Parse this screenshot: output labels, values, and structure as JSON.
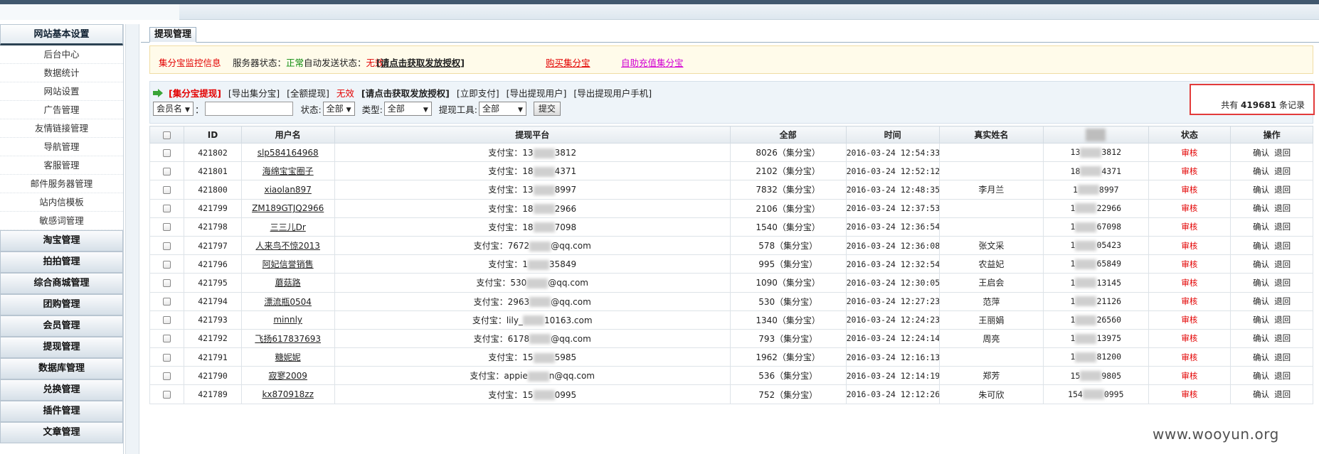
{
  "sidebar": {
    "title": "网站基本设置",
    "items": [
      "后台中心",
      "数据统计",
      "网站设置",
      "广告管理",
      "友情链接管理",
      "导航管理",
      "客服管理",
      "邮件服务器管理",
      "站内信模板",
      "敏感词管理"
    ],
    "groups": [
      "淘宝管理",
      "拍拍管理",
      "综合商城管理",
      "团购管理",
      "会员管理",
      "提现管理",
      "数据库管理",
      "兑换管理",
      "插件管理",
      "文章管理"
    ]
  },
  "tab": {
    "label": "提现管理"
  },
  "monitor": {
    "title": "集分宝监控信息",
    "server_label": "服务器状态：",
    "server_value": "正常",
    "auto_label": "自动发送状态：",
    "auto_value": "无效",
    "auth_link": "[请点击获取发放授权]",
    "buy_link": "购买集分宝",
    "recharge_link": "自助充值集分宝"
  },
  "links": {
    "jfb_withdraw": "[集分宝提现]",
    "export_jfb": "[导出集分宝]",
    "full_withdraw": "[全额提现]",
    "invalid": "无效",
    "auth": "[请点击获取发放授权]",
    "pay_now": "[立即支付]",
    "export_users": "[导出提现用户]",
    "export_phones": "[导出提现用户手机]"
  },
  "filters": {
    "member_select": "会员名",
    "colon": "：",
    "status_label": "状态:",
    "status_value": "全部",
    "type_label": "类型:",
    "type_value": "全部",
    "tool_label": "提现工具:",
    "tool_value": "全部",
    "submit": "提交"
  },
  "total": {
    "prefix": "共有",
    "count": "419681",
    "suffix": "条记录"
  },
  "table": {
    "headers": [
      "ID",
      "用户名",
      "提现平台",
      "全部",
      "时间",
      "真实姓名",
      "状态",
      "操作"
    ],
    "status_text": "审核",
    "op_confirm": "确认",
    "op_back": "退回",
    "rows": [
      {
        "id": "421802",
        "user": "slp584164968",
        "platform_a": "支付宝：13",
        "platform_b": "3812",
        "amount": "8026（集分宝）",
        "time": "2016-03-24 12:54:33",
        "name": "",
        "phone_a": "13",
        "phone_b": "3812"
      },
      {
        "id": "421801",
        "user": "海绵宝宝圈子",
        "platform_a": "支付宝：18",
        "platform_b": "4371",
        "amount": "2102（集分宝）",
        "time": "2016-03-24 12:52:12",
        "name": "",
        "phone_a": "18",
        "phone_b": "4371"
      },
      {
        "id": "421800",
        "user": "xiaolan897",
        "platform_a": "支付宝：13",
        "platform_b": "8997",
        "amount": "7832（集分宝）",
        "time": "2016-03-24 12:48:35",
        "name": "李月兰",
        "phone_a": "1",
        "phone_b": "8997"
      },
      {
        "id": "421799",
        "user": "ZM189GTJQ2966",
        "platform_a": "支付宝：18",
        "platform_b": "2966",
        "amount": "2106（集分宝）",
        "time": "2016-03-24 12:37:53",
        "name": "",
        "phone_a": "1",
        "phone_b": "22966"
      },
      {
        "id": "421798",
        "user": "三三儿Dr",
        "platform_a": "支付宝：18",
        "platform_b": "7098",
        "amount": "1540（集分宝）",
        "time": "2016-03-24 12:36:54",
        "name": "",
        "phone_a": "1",
        "phone_b": "67098"
      },
      {
        "id": "421797",
        "user": "人来鸟不惊2013",
        "platform_a": "支付宝：7672",
        "platform_b": "@qq.com",
        "amount": "578（集分宝）",
        "time": "2016-03-24 12:36:08",
        "name": "张文采",
        "phone_a": "1",
        "phone_b": "05423"
      },
      {
        "id": "421796",
        "user": "阿妃信誉销售",
        "platform_a": "支付宝：1",
        "platform_b": "35849",
        "amount": "995（集分宝）",
        "time": "2016-03-24 12:32:54",
        "name": "农益妃",
        "phone_a": "1",
        "phone_b": "65849"
      },
      {
        "id": "421795",
        "user": "蘑菇路",
        "platform_a": "支付宝：530",
        "platform_b": "@qq.com",
        "amount": "1090（集分宝）",
        "time": "2016-03-24 12:30:05",
        "name": "王启会",
        "phone_a": "1",
        "phone_b": "13145"
      },
      {
        "id": "421794",
        "user": "漂流瓶0504",
        "platform_a": "支付宝：2963",
        "platform_b": "@qq.com",
        "amount": "530（集分宝）",
        "time": "2016-03-24 12:27:23",
        "name": "范萍",
        "phone_a": "1",
        "phone_b": "21126"
      },
      {
        "id": "421793",
        "user": "minnly",
        "platform_a": "支付宝：lily_",
        "platform_b": "10163.com",
        "amount": "1340（集分宝）",
        "time": "2016-03-24 12:24:23",
        "name": "王丽娟",
        "phone_a": "1",
        "phone_b": "26560"
      },
      {
        "id": "421792",
        "user": "飞扬617837693",
        "platform_a": "支付宝：6178",
        "platform_b": "@qq.com",
        "amount": "793（集分宝）",
        "time": "2016-03-24 12:24:14",
        "name": "周亮",
        "phone_a": "1",
        "phone_b": "13975"
      },
      {
        "id": "421791",
        "user": "糖妮妮",
        "platform_a": "支付宝：15",
        "platform_b": "5985",
        "amount": "1962（集分宝）",
        "time": "2016-03-24 12:16:13",
        "name": "",
        "phone_a": "1",
        "phone_b": "81200"
      },
      {
        "id": "421790",
        "user": "寂寥2009",
        "platform_a": "支付宝：appie",
        "platform_b": "n@qq.com",
        "amount": "536（集分宝）",
        "time": "2016-03-24 12:14:19",
        "name": "郑芳",
        "phone_a": "15",
        "phone_b": "9805"
      },
      {
        "id": "421789",
        "user": "kx870918zz",
        "platform_a": "支付宝：15",
        "platform_b": "0995",
        "amount": "752（集分宝）",
        "time": "2016-03-24 12:12:26",
        "name": "朱可欣",
        "phone_a": "154",
        "phone_b": "0995"
      }
    ]
  },
  "watermark": "www.wooyun.org"
}
